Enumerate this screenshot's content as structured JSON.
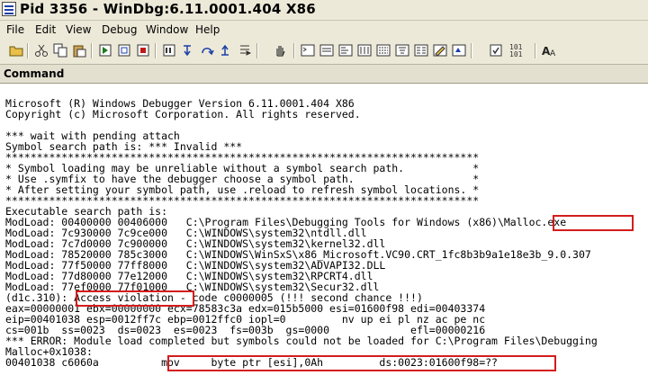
{
  "window": {
    "title": "Pid 3356 - WinDbg:6.11.0001.404 X86"
  },
  "menu": [
    "File",
    "Edit",
    "View",
    "Debug",
    "Window",
    "Help"
  ],
  "toolbar": {
    "icons": [
      "open-icon",
      "cut-icon",
      "copy-icon",
      "paste-icon",
      "go-icon",
      "restart-icon",
      "stop-icon",
      "break-icon",
      "step-into-icon",
      "step-over-icon",
      "step-out-icon",
      "run-to-cursor-icon",
      "hand-icon",
      "command-window-icon",
      "watch-icon",
      "locals-icon",
      "registers-icon",
      "memory-icon",
      "call-stack-icon",
      "disassembly-icon",
      "scratch-pad-icon",
      "source-mode-icon",
      "font-icon"
    ],
    "hex_label": "101\n101",
    "font_label": "AA"
  },
  "panel": {
    "title": "Command"
  },
  "output": {
    "lines": [
      "Microsoft (R) Windows Debugger Version 6.11.0001.404 X86",
      "Copyright (c) Microsoft Corporation. All rights reserved.",
      "",
      "*** wait with pending attach",
      "Symbol search path is: *** Invalid ***",
      "****************************************************************************",
      "* Symbol loading may be unreliable without a symbol search path.           *",
      "* Use .symfix to have the debugger choose a symbol path.                   *",
      "* After setting your symbol path, use .reload to refresh symbol locations. *",
      "****************************************************************************",
      "Executable search path is:",
      "ModLoad: 00400000 00406000   C:\\Program Files\\Debugging Tools for Windows (x86)\\Malloc.exe",
      "ModLoad: 7c930000 7c9ce000   C:\\WINDOWS\\system32\\ntdll.dll",
      "ModLoad: 7c7d0000 7c900000   C:\\WINDOWS\\system32\\kernel32.dll",
      "ModLoad: 78520000 785c3000   C:\\WINDOWS\\WinSxS\\x86_Microsoft.VC90.CRT_1fc8b3b9a1e18e3b_9.0.307",
      "ModLoad: 77f50000 77ff8000   C:\\WINDOWS\\system32\\ADVAPI32.DLL",
      "ModLoad: 77d80000 77e12000   C:\\WINDOWS\\system32\\RPCRT4.dll",
      "ModLoad: 77ef0000 77f01000   C:\\WINDOWS\\system32\\Secur32.dll",
      "(d1c.310): Access violation - code c0000005 (!!! second chance !!!)",
      "eax=00000001 ebx=00000000 ecx=78583c3a edx=015b5000 esi=01600f98 edi=00403374",
      "eip=00401038 esp=0012ff7c ebp=0012ffc0 iopl=0         nv up ei pl nz ac pe nc",
      "cs=001b  ss=0023  ds=0023  es=0023  fs=003b  gs=0000             efl=00000216",
      "*** ERROR: Module load completed but symbols could not be loaded for C:\\Program Files\\Debugging",
      "Malloc+0x1038:",
      "00401038 c6060a          mov     byte ptr [esi],0Ah         ds:0023:01600f98=??"
    ]
  }
}
